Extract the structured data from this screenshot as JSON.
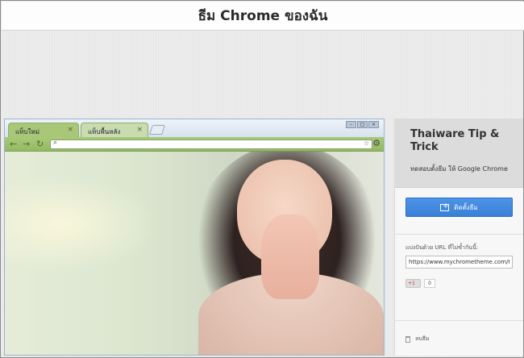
{
  "header": {
    "title": "ธีม Chrome ของฉัน"
  },
  "browser": {
    "tabs": [
      {
        "label": "แท็บใหม่",
        "close": "×"
      },
      {
        "label": "แท็บพื้นหลัง",
        "close": "×"
      }
    ],
    "window_buttons": [
      "–",
      "□",
      "×"
    ],
    "nav": {
      "back": "←",
      "forward": "→",
      "reload": "↻",
      "search": "🔍",
      "star": "☆",
      "wrench": "🔧"
    },
    "omnibox_value": ""
  },
  "panel": {
    "title": "Thaiware Tip & Trick",
    "subtitle": "ทดสอบตั้งธีม ให้ Google Chrome",
    "install_label": "ติดตั้งธีม",
    "share_label": "แบ่งปันด้วย URL ที่ไม่ซ้ำกันนี้:",
    "share_url": "https://www.mychrometheme.com/t/4or",
    "gplus_label": "+1",
    "gplus_count": "0",
    "remove_label": "ลบธีม"
  },
  "colors": {
    "accent_blue": "#3a80d8",
    "tab_green": "#a8c878",
    "toolbar_green": "#95b963"
  }
}
